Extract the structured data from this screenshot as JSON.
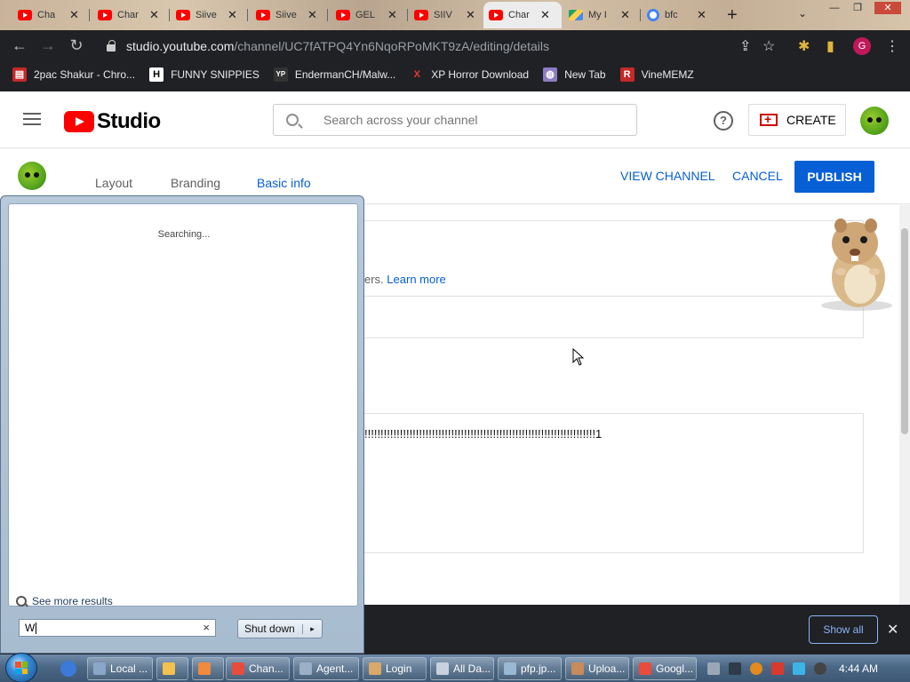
{
  "browser": {
    "tabs": [
      {
        "label": "Cha",
        "type": "youtube"
      },
      {
        "label": "Char",
        "type": "youtube"
      },
      {
        "label": "Siive",
        "type": "youtube"
      },
      {
        "label": "Siive",
        "type": "youtube"
      },
      {
        "label": "GEL",
        "type": "youtube"
      },
      {
        "label": "SIIV",
        "type": "youtube"
      },
      {
        "label": "Char",
        "type": "youtube",
        "active": true
      },
      {
        "label": "My I",
        "type": "drive"
      },
      {
        "label": "bfc",
        "type": "google"
      }
    ],
    "url_host": "studio.youtube.com",
    "url_path": "/channel/UC7fATPQ4Yn6NqoRPoMKT9zA/editing/details",
    "profile_initial": "G",
    "bookmarks": [
      {
        "label": "2pac Shakur - Chro...",
        "icon": "chrome-store-icon"
      },
      {
        "label": "FUNNY SNIPPIES",
        "icon": "h-icon"
      },
      {
        "label": "EndermanCH/Malw...",
        "icon": "yp-icon"
      },
      {
        "label": "XP Horror Download",
        "icon": "x-icon"
      },
      {
        "label": "New Tab",
        "icon": "globe-icon"
      },
      {
        "label": "VineMEMZ",
        "icon": "r-icon"
      }
    ]
  },
  "studio": {
    "logo_text": "Studio",
    "search_placeholder": "Search across your channel",
    "help_glyph": "?",
    "create_label": "CREATE",
    "tabs": [
      "Layout",
      "Branding",
      "Basic info"
    ],
    "active_tab": "Basic info",
    "view_channel": "VIEW CHANNEL",
    "cancel": "CANCEL",
    "publish": "PUBLISH",
    "partial_text": "ers.",
    "learn_more": "Learn more",
    "description_fragment": "!!!!!!!!!!!!!!!!!!!!!!!!!!!!!!!!!!!!!!!!!!!!!!!!!!!!!!!!!!!!!!!!!!!!!!!!1"
  },
  "download_bar": {
    "show_all": "Show all",
    "close_glyph": "✕"
  },
  "start_menu": {
    "status": "Searching...",
    "see_more": "See more results",
    "search_value": "W",
    "clear_glyph": "×",
    "shutdown": "Shut down",
    "shutdown_arrow": "▸"
  },
  "taskbar": {
    "buttons": [
      {
        "label": "Local ...",
        "color": "#8aa6c9"
      },
      {
        "label": "",
        "color": "#f2c14e"
      },
      {
        "label": "",
        "color": "#f08a3c"
      },
      {
        "label": "Chan...",
        "color": "#e74c3c"
      },
      {
        "label": "Agent...",
        "color": "#9bb0c7"
      },
      {
        "label": "Login",
        "color": "#d9a86a"
      },
      {
        "label": "All Da...",
        "color": "#c8d2de"
      },
      {
        "label": "pfp.jp...",
        "color": "#9ab7d3"
      },
      {
        "label": "Uploa...",
        "color": "#c98b5a"
      },
      {
        "label": "Googl...",
        "color": "#e74c3c"
      }
    ],
    "clock": "4:44 AM"
  }
}
